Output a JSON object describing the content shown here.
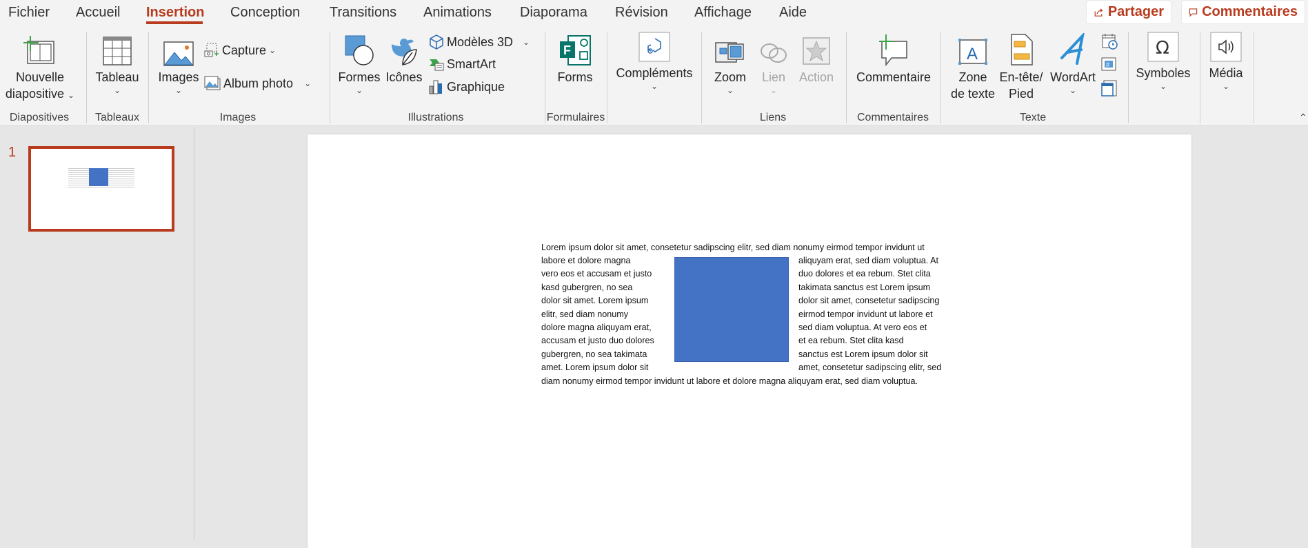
{
  "menu": {
    "tabs": [
      "Fichier",
      "Accueil",
      "Insertion",
      "Conception",
      "Transitions",
      "Animations",
      "Diaporama",
      "Révision",
      "Affichage",
      "Aide"
    ],
    "active_tab": "Insertion",
    "share_label": "Partager",
    "comments_label": "Commentaires"
  },
  "ribbon": {
    "groups": {
      "diapositives": "Diapositives",
      "tableaux": "Tableaux",
      "images": "Images",
      "illustrations": "Illustrations",
      "formulaires": "Formulaires",
      "liens": "Liens",
      "commentaires": "Commentaires",
      "texte": "Texte"
    },
    "buttons": {
      "new_slide_1": "Nouvelle",
      "new_slide_2": "diapositive",
      "table": "Tableau",
      "images": "Images",
      "capture": "Capture",
      "album": "Album photo",
      "shapes": "Formes",
      "icons": "Icônes",
      "models3d": "Modèles 3D",
      "smartart": "SmartArt",
      "chart": "Graphique",
      "forms": "Forms",
      "addins": "Compléments",
      "zoom": "Zoom",
      "link": "Lien",
      "action": "Action",
      "comment": "Commentaire",
      "textbox_1": "Zone",
      "textbox_2": "de texte",
      "header_1": "En-tête/",
      "header_2": "Pied",
      "wordart": "WordArt",
      "symbols": "Symboles",
      "media": "Média"
    }
  },
  "slides": {
    "current_number": "1"
  },
  "slide_text": {
    "top": "Lorem ipsum dolor sit amet, consetetur sadipscing elitr, sed diam nonumy eirmod tempor invidunt ut",
    "left": [
      "labore et dolore magna",
      "vero eos et accusam et justo",
      "kasd gubergren, no sea",
      "dolor sit amet. Lorem ipsum",
      "elitr, sed diam nonumy",
      "dolore magna aliquyam erat,",
      "accusam et justo duo dolores",
      "gubergren, no sea takimata",
      "amet. Lorem ipsum dolor sit"
    ],
    "right": [
      "aliquyam erat, sed diam voluptua. At",
      "duo dolores et ea rebum. Stet clita",
      "takimata sanctus est Lorem ipsum",
      "dolor sit amet, consetetur sadipscing",
      "eirmod tempor invidunt ut labore et",
      "sed diam voluptua. At vero eos et",
      "et ea rebum. Stet clita kasd",
      "sanctus est Lorem ipsum dolor sit",
      "amet, consetetur sadipscing elitr, sed"
    ],
    "bottom": "diam nonumy eirmod tempor invidunt ut labore et dolore magna aliquyam erat, sed diam voluptua."
  },
  "colors": {
    "accent": "#b83b1e",
    "shape_fill": "#4472c4"
  }
}
